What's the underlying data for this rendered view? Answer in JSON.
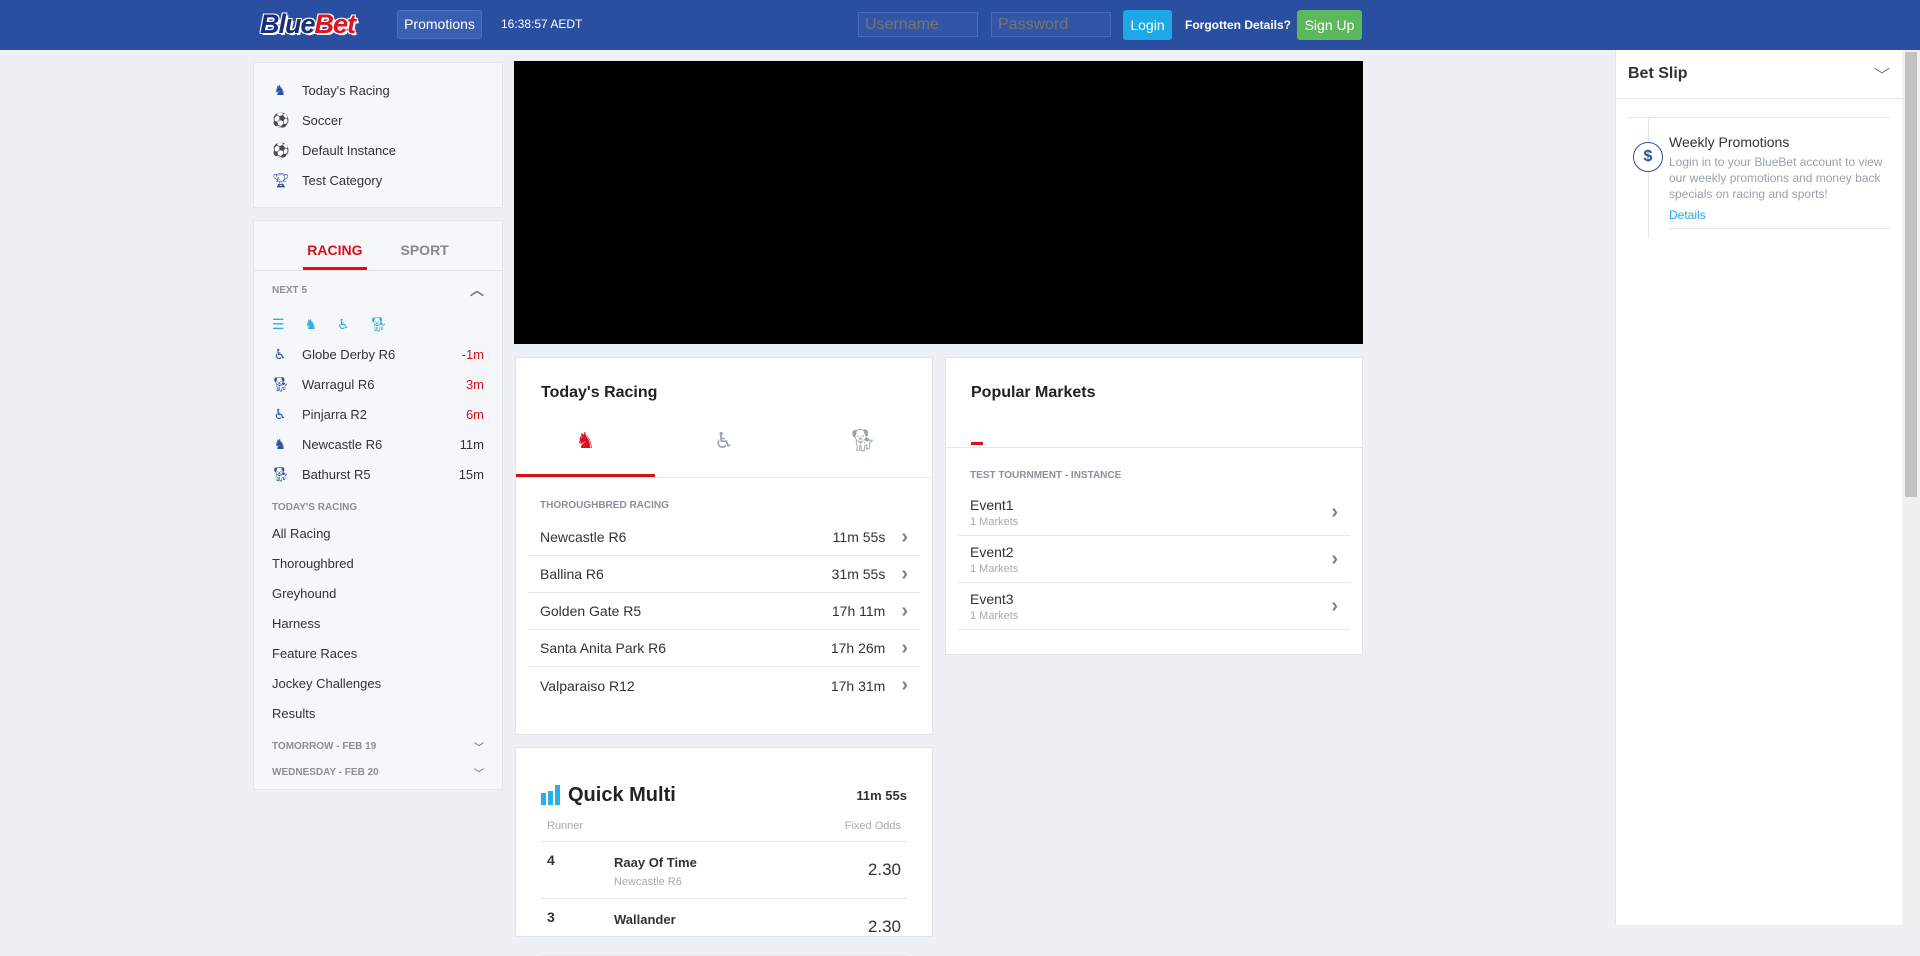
{
  "header": {
    "logo_blue": "Blue",
    "logo_red": "Bet",
    "promotions": "Promotions",
    "time": "16:38:57 AEDT",
    "username_placeholder": "Username",
    "password_placeholder": "Password",
    "login": "Login",
    "forgotten": "Forgotten Details?",
    "signup": "Sign Up"
  },
  "sidebar": {
    "categories": [
      {
        "label": "Today's Racing",
        "icon": "horse-icon"
      },
      {
        "label": "Soccer",
        "icon": "soccer-ball-icon"
      },
      {
        "label": "Default Instance",
        "icon": "soccer-ball-icon"
      },
      {
        "label": "Test Category",
        "icon": "trophy-icon"
      }
    ],
    "tabs": [
      "RACING",
      "SPORT"
    ],
    "next5_label": "NEXT 5",
    "next5": [
      {
        "name": "Globe Derby R6",
        "time": "-1m",
        "urgent": true,
        "icon": "harness-icon"
      },
      {
        "name": "Warragul R6",
        "time": "3m",
        "urgent": true,
        "icon": "greyhound-icon"
      },
      {
        "name": "Pinjarra R2",
        "time": "6m",
        "urgent": true,
        "icon": "harness-icon"
      },
      {
        "name": "Newcastle R6",
        "time": "11m",
        "urgent": false,
        "icon": "horse-icon"
      },
      {
        "name": "Bathurst R5",
        "time": "15m",
        "urgent": false,
        "icon": "greyhound-icon"
      }
    ],
    "todays_label": "TODAY'S RACING",
    "links": [
      "All Racing",
      "Thoroughbred",
      "Greyhound",
      "Harness",
      "Feature Races",
      "Jockey Challenges",
      "Results"
    ],
    "tomorrow": "TOMORROW - FEB 19",
    "wednesday": "WEDNESDAY - FEB 20"
  },
  "todays_racing": {
    "title": "Today's Racing",
    "section": "THOROUGHBRED RACING",
    "races": [
      {
        "name": "Newcastle R6",
        "time": "11m 55s"
      },
      {
        "name": "Ballina R6",
        "time": "31m 55s"
      },
      {
        "name": "Golden Gate R5",
        "time": "17h 11m"
      },
      {
        "name": "Santa Anita Park R6",
        "time": "17h 26m"
      },
      {
        "name": "Valparaiso R12",
        "time": "17h 31m"
      }
    ]
  },
  "popular": {
    "title": "Popular Markets",
    "section": "TEST TOURNMENT - INSTANCE",
    "events": [
      {
        "name": "Event1",
        "markets": "1 Markets"
      },
      {
        "name": "Event2",
        "markets": "1 Markets"
      },
      {
        "name": "Event3",
        "markets": "1 Markets"
      }
    ]
  },
  "quick_multi": {
    "title": "Quick Multi",
    "time": "11m 55s",
    "col_runner": "Runner",
    "col_odds": "Fixed Odds",
    "runners": [
      {
        "num": "4",
        "name": "Raay Of Time",
        "race": "Newcastle R6",
        "odds": "2.30"
      },
      {
        "num": "3",
        "name": "Wallander",
        "race": "",
        "odds": "2.30"
      }
    ]
  },
  "betslip": {
    "title": "Bet Slip",
    "promo_title": "Weekly Promotions",
    "promo_text": "Login in to your BlueBet account to view our weekly promotions and money back specials on racing and sports!",
    "details": "Details"
  }
}
